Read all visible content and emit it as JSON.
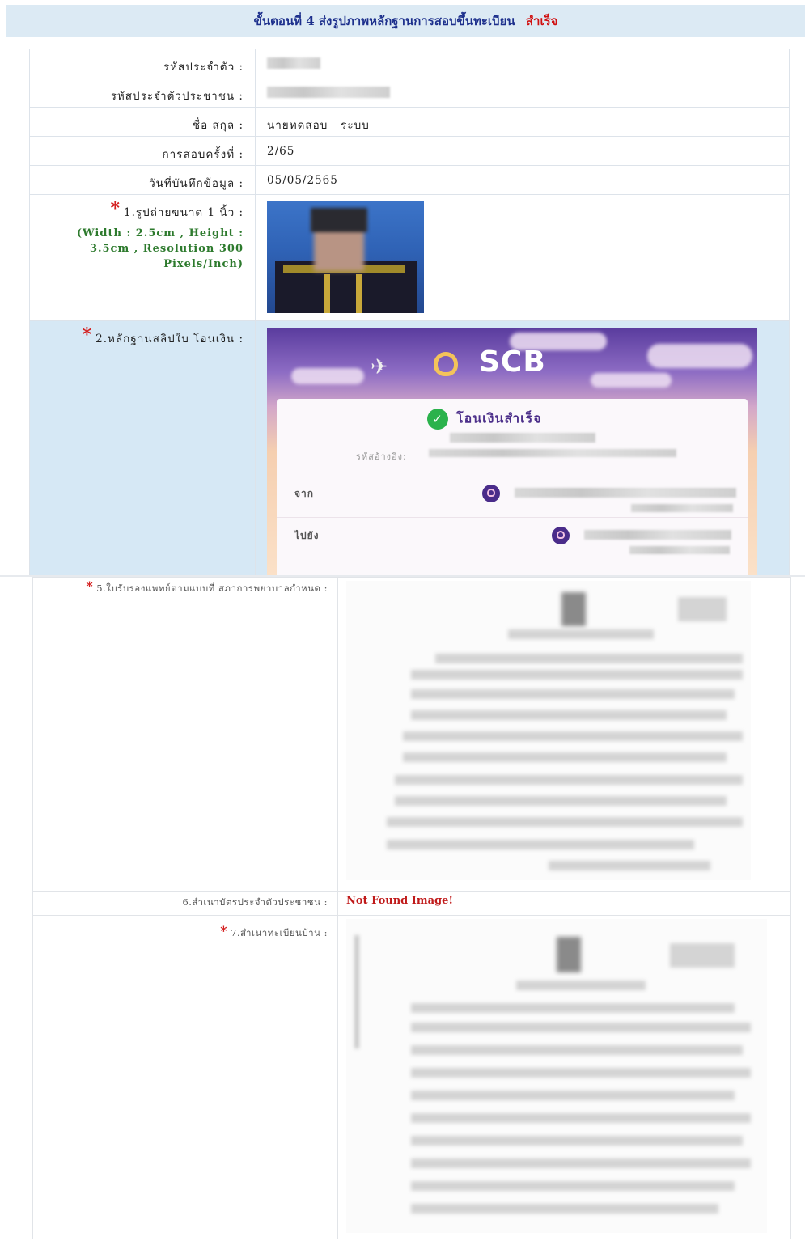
{
  "header": {
    "title": "ขั้นตอนที่ 4 ส่งรูปภาพหลักฐานการสอบขึ้นทะเบียน",
    "status": "สำเร็จ"
  },
  "fields": {
    "student_id": {
      "label": "รหัสประจำตัว :"
    },
    "national_id": {
      "label": "รหัสประจำตัวประชาชน :"
    },
    "name": {
      "label": "ชื่อ สกุล :",
      "value": "นายทดสอบ   ระบบ"
    },
    "exam_round": {
      "label": "การสอบครั้งที่ :",
      "value": "2/65"
    },
    "record_date": {
      "label": "วันที่บันทึกข้อมูล :",
      "value": "05/05/2565"
    }
  },
  "uploads": {
    "photo": {
      "required_mark": "*",
      "label": "1.รูปถ่ายขนาด 1 นิ้ว :",
      "hint": "(Width : 2.5cm , Height : 3.5cm , Resolution 300 Pixels/Inch)"
    },
    "payment_slip": {
      "required_mark": "*",
      "label": "2.หลักฐานสลิปใบ โอนเงิน :",
      "slip": {
        "bank": "SCB",
        "success_text": "โอนเงินสำเร็จ",
        "ref_label": "รหัสอ้างอิง:",
        "from_label": "จาก",
        "to_label": "ไปยัง"
      }
    },
    "medical_cert": {
      "required_mark": "*",
      "label": "5.ใบรับรองแพทย์ตามแบบที่ สภาการพยาบาลกำหนด :"
    },
    "id_card_copy": {
      "label": "6.สำเนาบัตรประจำตัวประชาชน :",
      "value": "Not Found Image!"
    },
    "house_registration": {
      "required_mark": "*",
      "label": "7.สำเนาทะเบียนบ้าน :"
    }
  },
  "colors": {
    "header_bg": "#dceaf4",
    "header_text": "#1c2f8c",
    "status": "#d01010",
    "required": "#d41f1f",
    "hint": "#2d7a2d",
    "highlight_row": "#d6e8f5",
    "not_found": "#c01a1a"
  }
}
